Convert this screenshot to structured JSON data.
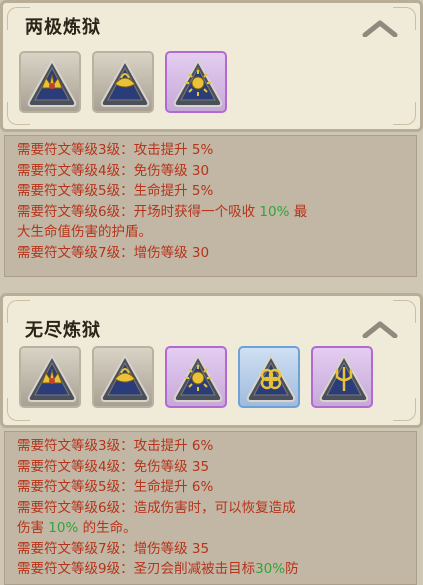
{
  "sections": [
    {
      "title": "两极炼狱",
      "icons": [
        {
          "name": "crown-rune-icon",
          "frame": "grey",
          "emblem": "crown"
        },
        {
          "name": "lamp-rune-icon",
          "frame": "grey",
          "emblem": "lamp"
        },
        {
          "name": "sun-rune-icon",
          "frame": "purple",
          "emblem": "sun"
        }
      ],
      "bonuses": [
        {
          "req": "需要符文等级3级：",
          "text": "攻击提升 5%",
          "hl": "",
          "tail": ""
        },
        {
          "req": "需要符文等级4级：",
          "text": "免伤等级 30",
          "hl": "",
          "tail": ""
        },
        {
          "req": "需要符文等级5级：",
          "text": "生命提升 5%",
          "hl": "",
          "tail": ""
        },
        {
          "req": "需要符文等级6级：",
          "text": "开场时获得一个吸收 ",
          "hl": "10%",
          "tail": " 最"
        },
        {
          "req": "",
          "text": "大生命值伤害的护盾。",
          "hl": "",
          "tail": ""
        },
        {
          "req": "需要符文等级7级：",
          "text": "增伤等级 30",
          "hl": "",
          "tail": ""
        }
      ]
    },
    {
      "title": "无尽炼狱",
      "icons": [
        {
          "name": "crown-rune-icon",
          "frame": "grey",
          "emblem": "crown"
        },
        {
          "name": "lamp-rune-icon",
          "frame": "grey",
          "emblem": "lamp"
        },
        {
          "name": "sun-rune-icon",
          "frame": "purple",
          "emblem": "sun"
        },
        {
          "name": "knot-rune-icon",
          "frame": "blue",
          "emblem": "knot"
        },
        {
          "name": "trident-rune-icon",
          "frame": "purple",
          "emblem": "trident"
        }
      ],
      "bonuses": [
        {
          "req": "需要符文等级3级：",
          "text": "攻击提升 6%",
          "hl": "",
          "tail": ""
        },
        {
          "req": "需要符文等级4级：",
          "text": "免伤等级 35",
          "hl": "",
          "tail": ""
        },
        {
          "req": "需要符文等级5级：",
          "text": "生命提升 6%",
          "hl": "",
          "tail": ""
        },
        {
          "req": "需要符文等级6级：",
          "text": "造成伤害时，可以恢复造成",
          "hl": "",
          "tail": ""
        },
        {
          "req": "",
          "text": "伤害 ",
          "hl": "10%",
          "tail": " 的生命。"
        },
        {
          "req": "需要符文等级7级：",
          "text": "增伤等级 35",
          "hl": "",
          "tail": ""
        },
        {
          "req": "需要符文等级9级：",
          "text": "圣刃会削减被击目标",
          "hl": "30%",
          "tail": "防"
        }
      ]
    }
  ],
  "colors": {
    "text_red": "#b5341b",
    "highlight_green": "#2fa53a",
    "panel_bg": "#f0ead9"
  }
}
